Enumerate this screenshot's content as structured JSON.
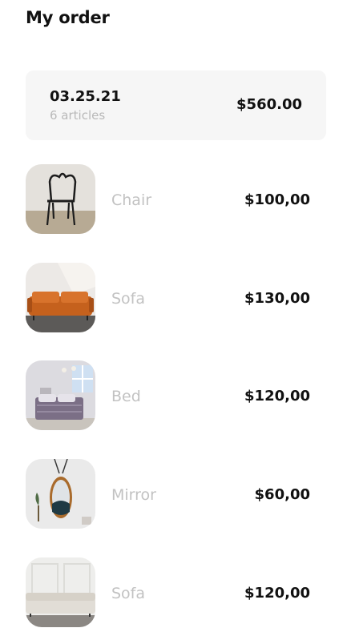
{
  "page": {
    "title": "My order"
  },
  "order": {
    "date": "03.25.21",
    "articles": "6 articles",
    "total": "$560.00"
  },
  "items": [
    {
      "name": "Chair",
      "price": "$100,00",
      "image": "chair-photo"
    },
    {
      "name": "Sofa",
      "price": "$130,00",
      "image": "orange-sofa-photo"
    },
    {
      "name": "Bed",
      "price": "$120,00",
      "image": "bed-photo"
    },
    {
      "name": "Mirror",
      "price": "$60,00",
      "image": "round-mirror-photo"
    },
    {
      "name": "Sofa",
      "price": "$120,00",
      "image": "white-sofa-photo"
    }
  ]
}
